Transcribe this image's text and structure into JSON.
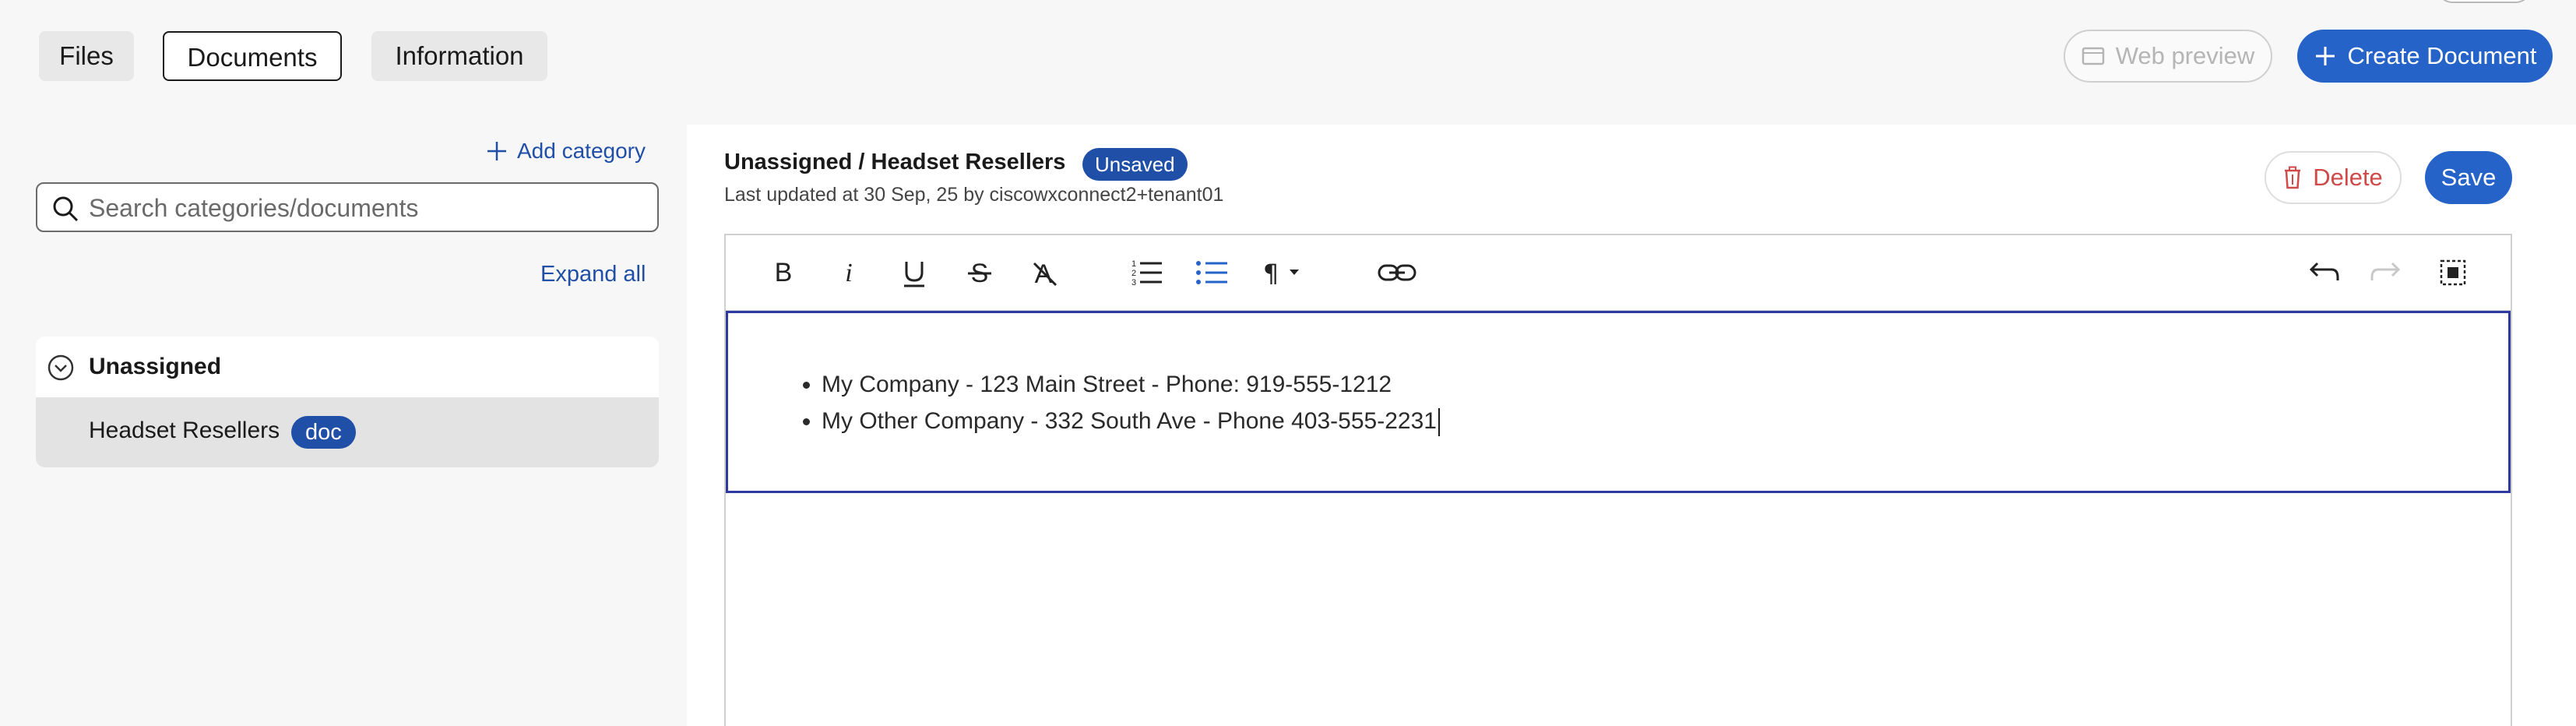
{
  "tabs": [
    {
      "label": "Files",
      "active": false
    },
    {
      "label": "Documents",
      "active": true
    },
    {
      "label": "Information",
      "active": false
    }
  ],
  "header_actions": {
    "web_preview_label": "Web preview",
    "create_document_label": "Create Document"
  },
  "sidebar": {
    "add_category_label": "Add category",
    "search_placeholder": "Search categories/documents",
    "search_value": "",
    "expand_all_label": "Expand all",
    "tree": {
      "category": "Unassigned",
      "document": "Headset Resellers",
      "document_badge": "doc"
    }
  },
  "document": {
    "breadcrumb": "Unassigned / Headset Resellers",
    "status_badge": "Unsaved",
    "last_updated": "Last updated at 30 Sep, 25 by ciscowxconnect2+tenant01",
    "delete_label": "Delete",
    "save_label": "Save"
  },
  "editor": {
    "toolbar_icons": [
      "bold-icon",
      "italic-icon",
      "underline-icon",
      "strikethrough-icon",
      "clear-format-icon",
      "ordered-list-icon",
      "bullet-list-icon",
      "paragraph-icon",
      "link-icon",
      "undo-icon",
      "redo-icon",
      "select-all-icon"
    ],
    "bullets": [
      "My Company - 123 Main Street - Phone: 919-555-1212",
      "My Other Company - 332 South Ave - Phone 403-555-2231"
    ]
  },
  "colors": {
    "accent": "#2563c9",
    "badge": "#1f4fa6",
    "delete": "#d04a4a",
    "editor_focus_border": "#2d3aa0"
  }
}
